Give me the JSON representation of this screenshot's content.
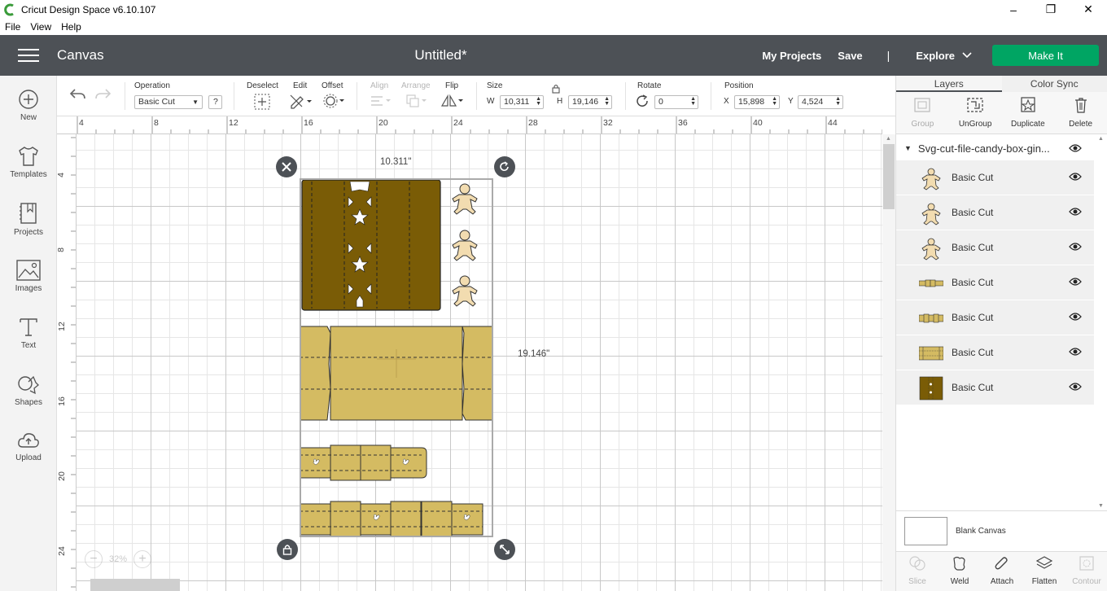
{
  "window": {
    "title": "Cricut Design Space  v6.10.107"
  },
  "menu": [
    "File",
    "View",
    "Help"
  ],
  "header": {
    "section": "Canvas",
    "doc_title": "Untitled*",
    "my_projects": "My Projects",
    "save": "Save",
    "separator": "|",
    "explore": "Explore",
    "make_it": "Make It"
  },
  "sidebar": [
    {
      "label": "New",
      "icon": "plus-circle-icon"
    },
    {
      "label": "Templates",
      "icon": "tshirt-icon"
    },
    {
      "label": "Projects",
      "icon": "bookmark-book-icon"
    },
    {
      "label": "Images",
      "icon": "image-icon"
    },
    {
      "label": "Text",
      "icon": "text-icon"
    },
    {
      "label": "Shapes",
      "icon": "shapes-icon"
    },
    {
      "label": "Upload",
      "icon": "cloud-upload-icon"
    }
  ],
  "toolbar": {
    "operation_label": "Operation",
    "operation_value": "Basic Cut",
    "help": "?",
    "deselect": "Deselect",
    "edit": "Edit",
    "offset": "Offset",
    "align": "Align",
    "arrange": "Arrange",
    "flip": "Flip",
    "size": "Size",
    "w_label": "W",
    "w_value": "10,311",
    "h_label": "H",
    "h_value": "19,146",
    "rotate": "Rotate",
    "rotate_value": "0",
    "position": "Position",
    "x_label": "X",
    "x_value": "15,898",
    "y_label": "Y",
    "y_value": "4,524"
  },
  "ruler_top": [
    "4",
    "8",
    "12",
    "16",
    "20",
    "24",
    "28",
    "32",
    "36",
    "40",
    "44"
  ],
  "ruler_left": [
    "4",
    "8",
    "12",
    "16",
    "20",
    "24"
  ],
  "canvas": {
    "width_dim": "10.311\"",
    "height_dim": "19.146\"",
    "zoom": "32%"
  },
  "panel": {
    "tab_layers": "Layers",
    "tab_color_sync": "Color Sync",
    "actions": [
      {
        "label": "Group",
        "disabled": true,
        "icon": "group-icon"
      },
      {
        "label": "UnGroup",
        "disabled": false,
        "icon": "ungroup-icon"
      },
      {
        "label": "Duplicate",
        "disabled": false,
        "icon": "duplicate-icon"
      },
      {
        "label": "Delete",
        "disabled": false,
        "icon": "trash-icon"
      }
    ],
    "group_name": "Svg-cut-file-candy-box-gin...",
    "layers": [
      {
        "name": "Basic Cut",
        "thumb": "gingerbread"
      },
      {
        "name": "Basic Cut",
        "thumb": "gingerbread"
      },
      {
        "name": "Basic Cut",
        "thumb": "gingerbread"
      },
      {
        "name": "Basic Cut",
        "thumb": "strip"
      },
      {
        "name": "Basic Cut",
        "thumb": "strip2"
      },
      {
        "name": "Basic Cut",
        "thumb": "box"
      },
      {
        "name": "Basic Cut",
        "thumb": "darkpanel"
      }
    ],
    "blank_canvas": "Blank Canvas",
    "bottom_actions": [
      {
        "label": "Slice",
        "disabled": true
      },
      {
        "label": "Weld",
        "disabled": false
      },
      {
        "label": "Attach",
        "disabled": false
      },
      {
        "label": "Flatten",
        "disabled": false
      },
      {
        "label": "Contour",
        "disabled": true
      }
    ]
  },
  "colors": {
    "header_bg": "#4d5156",
    "make_it": "#00a563",
    "dark_material": "#7a5c06",
    "light_material": "#d4bb62"
  }
}
